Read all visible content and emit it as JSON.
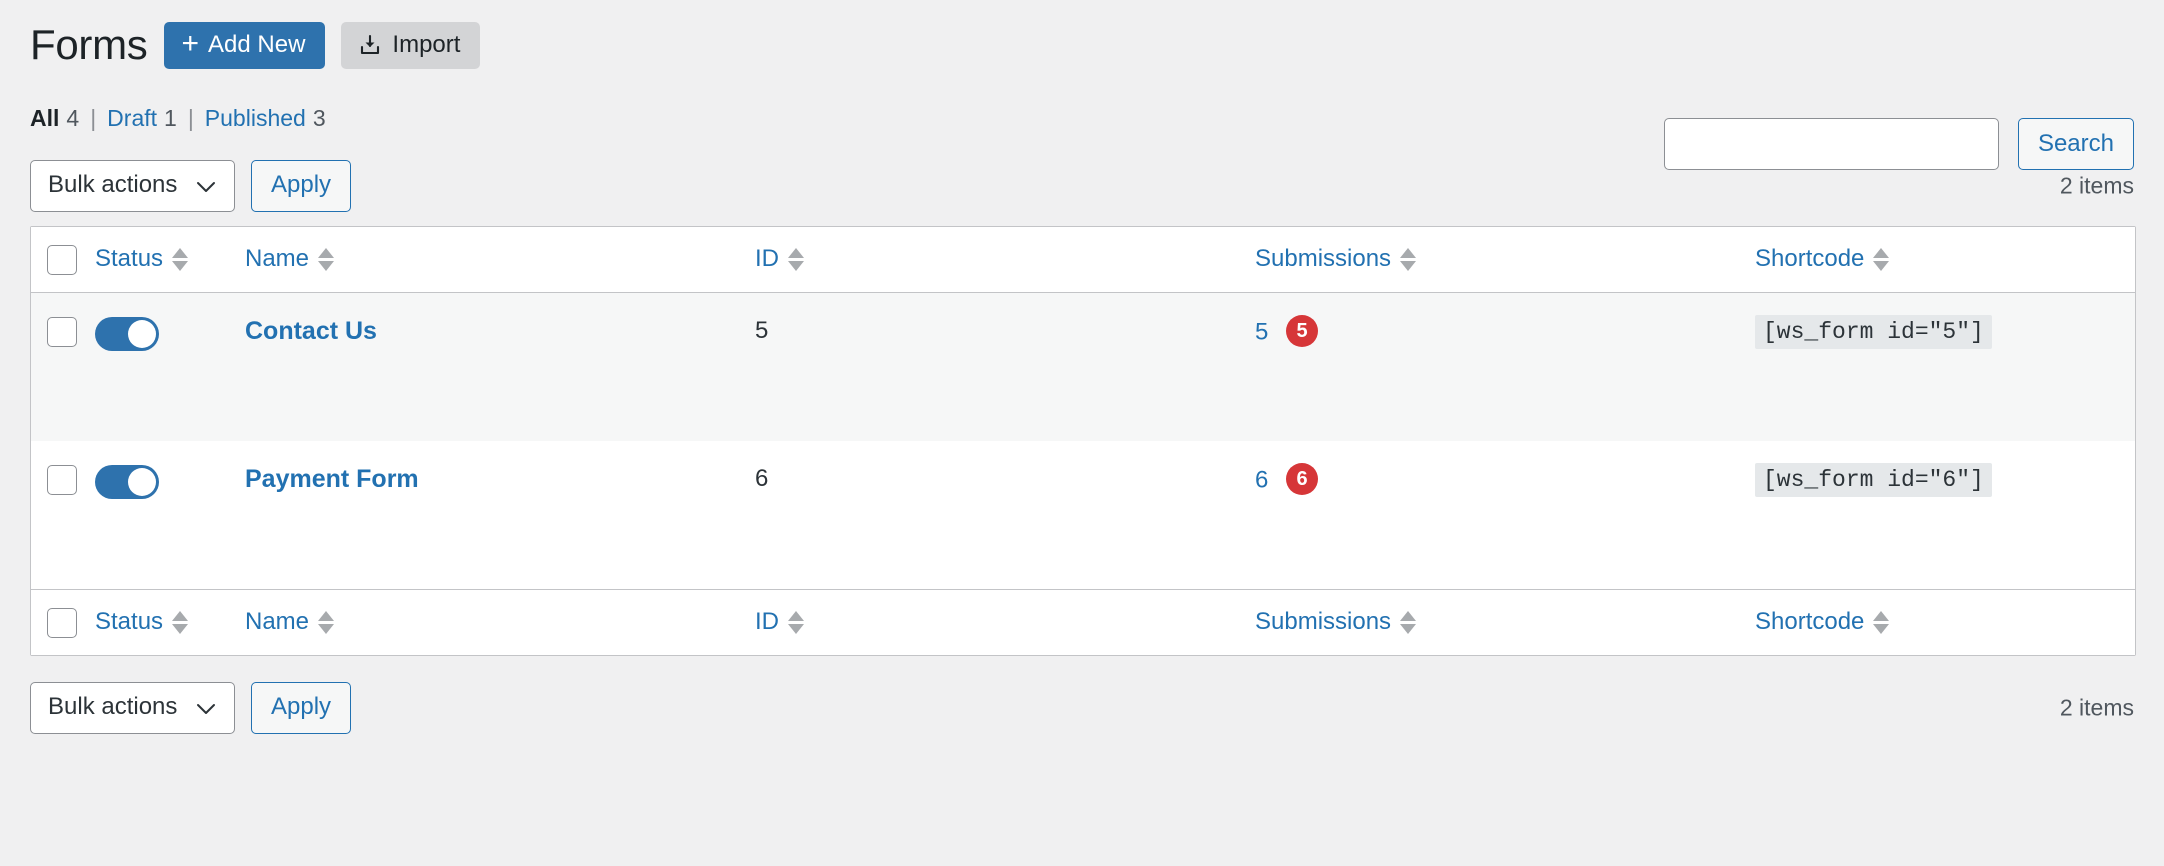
{
  "header": {
    "title": "Forms",
    "add_new_label": "Add New",
    "add_new_icon": "plus-icon",
    "import_label": "Import",
    "import_icon": "import-download-icon"
  },
  "filters": [
    {
      "label": "All",
      "count": "4",
      "current": true
    },
    {
      "label": "Draft",
      "count": "1",
      "current": false
    },
    {
      "label": "Published",
      "count": "3",
      "current": false
    }
  ],
  "filter_separator": "|",
  "search": {
    "value": "",
    "placeholder": "",
    "button_label": "Search"
  },
  "tablenav_top": {
    "bulk_selected": "Bulk actions",
    "apply_label": "Apply",
    "displaying_num": "2 items"
  },
  "tablenav_bottom": {
    "bulk_selected": "Bulk actions",
    "apply_label": "Apply",
    "displaying_num": "2 items"
  },
  "bulk_options": [
    "Bulk actions"
  ],
  "table": {
    "columns": [
      {
        "key": "status",
        "label": "Status",
        "sortable": true
      },
      {
        "key": "name",
        "label": "Name",
        "sortable": true
      },
      {
        "key": "id",
        "label": "ID",
        "sortable": true
      },
      {
        "key": "submissions",
        "label": "Submissions",
        "sortable": true
      },
      {
        "key": "shortcode",
        "label": "Shortcode",
        "sortable": true
      }
    ],
    "rows": [
      {
        "checked": false,
        "status_on": true,
        "name": "Contact Us",
        "id": "5",
        "submissions": "5",
        "submissions_badge": "5",
        "shortcode": "[ws_form id=\"5\"]"
      },
      {
        "checked": false,
        "status_on": true,
        "name": "Payment Form",
        "id": "6",
        "submissions": "6",
        "submissions_badge": "6",
        "shortcode": "[ws_form id=\"6\"]"
      }
    ]
  },
  "colors": {
    "accent_blue": "#2271b1",
    "button_blue": "#2e72ad",
    "badge_red": "#d63638",
    "page_bg": "#f0f0f1",
    "alt_row": "#f6f7f7"
  }
}
